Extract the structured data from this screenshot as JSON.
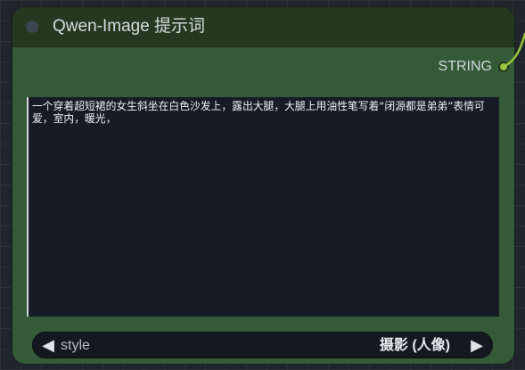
{
  "node": {
    "title": "Qwen-Image 提示词",
    "output_label": "STRING",
    "prompt_text": "一个穿着超短裙的女生斜坐在白色沙发上，露出大腿，大腿上用油性笔写着“闭源都是弟弟”表情可爱，室内，暖光，",
    "style_label": "style",
    "style_value": "摄影 (人像)"
  },
  "icons": {
    "left_arrow": "◀",
    "right_arrow": "▶"
  },
  "colors": {
    "node_body": "#355a38",
    "node_header": "#24391f",
    "text_area": "#161b26",
    "output_slot": "#95c63d",
    "link_wire": "#95c63d"
  }
}
